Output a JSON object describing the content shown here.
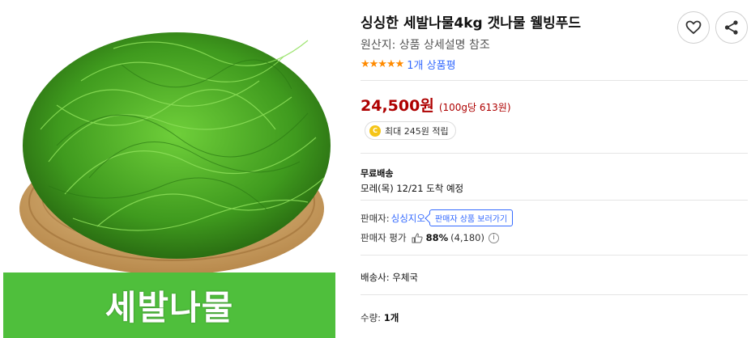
{
  "product": {
    "image_caption": "세발나물",
    "title": "싱싱한 세발나물4kg 갯나물 웰빙푸드",
    "origin": "원산지: 상품 상세설명 참조",
    "rating_stars": "★★★★★",
    "review_count": "1개 상품평",
    "price": "24,500원",
    "unit_price": "(100g당 613원)",
    "points_icon": "C",
    "points_text": "최대 245원 적립"
  },
  "actions": {
    "wishlist_icon": "heart-icon",
    "share_icon": "share-icon"
  },
  "shipping": {
    "type": "무료배송",
    "arrival": "모레(목) 12/21 도착 예정"
  },
  "seller": {
    "label": "판매자:",
    "name": "싱싱지오",
    "view_products": "판매자 상품 보러가기",
    "rating_label": "판매자 평가",
    "rating_percent": "88%",
    "rating_count": "(4,180)"
  },
  "delivery": {
    "carrier": "배송사: 우체국"
  },
  "quantity": {
    "label": "수량:",
    "value": "1개"
  },
  "colors": {
    "price": "#ae0000",
    "link": "#346aff",
    "star": "#ff8a00",
    "caption_bg": "#4fbf3c"
  }
}
